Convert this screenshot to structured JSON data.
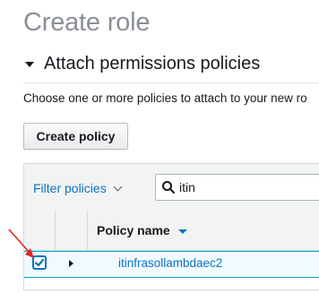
{
  "page": {
    "title": "Create role"
  },
  "section": {
    "title": "Attach permissions policies",
    "description": "Choose one or more policies to attach to your new ro"
  },
  "toolbar": {
    "create_policy_label": "Create policy"
  },
  "filter": {
    "label": "Filter policies",
    "search_value": "itin"
  },
  "table": {
    "columns": [
      "Policy name"
    ],
    "rows": [
      {
        "name": "itinfrasollambdaec2",
        "checked": true
      }
    ]
  },
  "icons": {
    "section_toggle": "caret-down-icon",
    "filter_dropdown": "chevron-down-icon",
    "search": "search-icon",
    "sort": "sort-caret-icon",
    "row_expand": "caret-right-icon",
    "checkbox": "checkmark-icon",
    "annotation": "arrow-icon"
  },
  "colors": {
    "link": "#0a72c5",
    "selected_row_bg": "#f1faff",
    "selected_row_border": "#00a1c9",
    "title_gray": "#8a8f96",
    "annotation_arrow": "#e02424"
  }
}
